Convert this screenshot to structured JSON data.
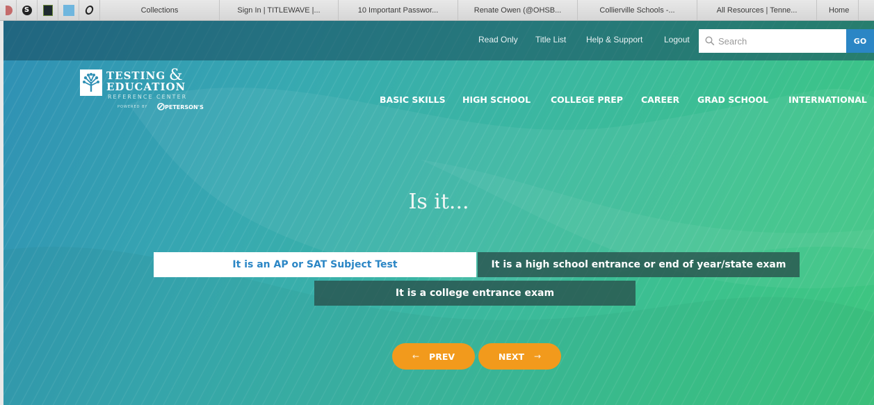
{
  "browser": {
    "tabs": [
      {
        "label": "Collections"
      },
      {
        "label": "Sign In | TITLEWAVE |..."
      },
      {
        "label": "10 Important Passwor..."
      },
      {
        "label": "Renate Owen (@OHSB..."
      },
      {
        "label": "Collierville Schools -..."
      },
      {
        "label": "All Resources | Tenne..."
      },
      {
        "label": "Home"
      }
    ]
  },
  "util_nav": {
    "read_only": "Read Only",
    "title_list": "Title List",
    "help": "Help & Support",
    "logout": "Logout",
    "search_placeholder": "Search",
    "go": "GO"
  },
  "logo": {
    "line1": "TESTING",
    "amp": "&",
    "line2": "EDUCATION",
    "line3": "REFERENCE CENTER",
    "powered": "POWERED BY",
    "brand": "PETERSON'S"
  },
  "main_nav": [
    {
      "label": "BASIC SKILLS"
    },
    {
      "label": "HIGH SCHOOL"
    },
    {
      "label": "COLLEGE PREP"
    },
    {
      "label": "CAREER"
    },
    {
      "label": "GRAD SCHOOL"
    },
    {
      "label": "INTERNATIONAL"
    }
  ],
  "quiz": {
    "question": "Is it...",
    "options": [
      {
        "label": "It is an AP or SAT Subject Test"
      },
      {
        "label": "It is a high school entrance or end of year/state exam"
      },
      {
        "label": "It is a college entrance exam"
      }
    ],
    "prev": "PREV",
    "next": "NEXT"
  },
  "colors": {
    "accent": "#2b86c5",
    "button": "#f29a1c",
    "option_dark": "#284e4a"
  }
}
